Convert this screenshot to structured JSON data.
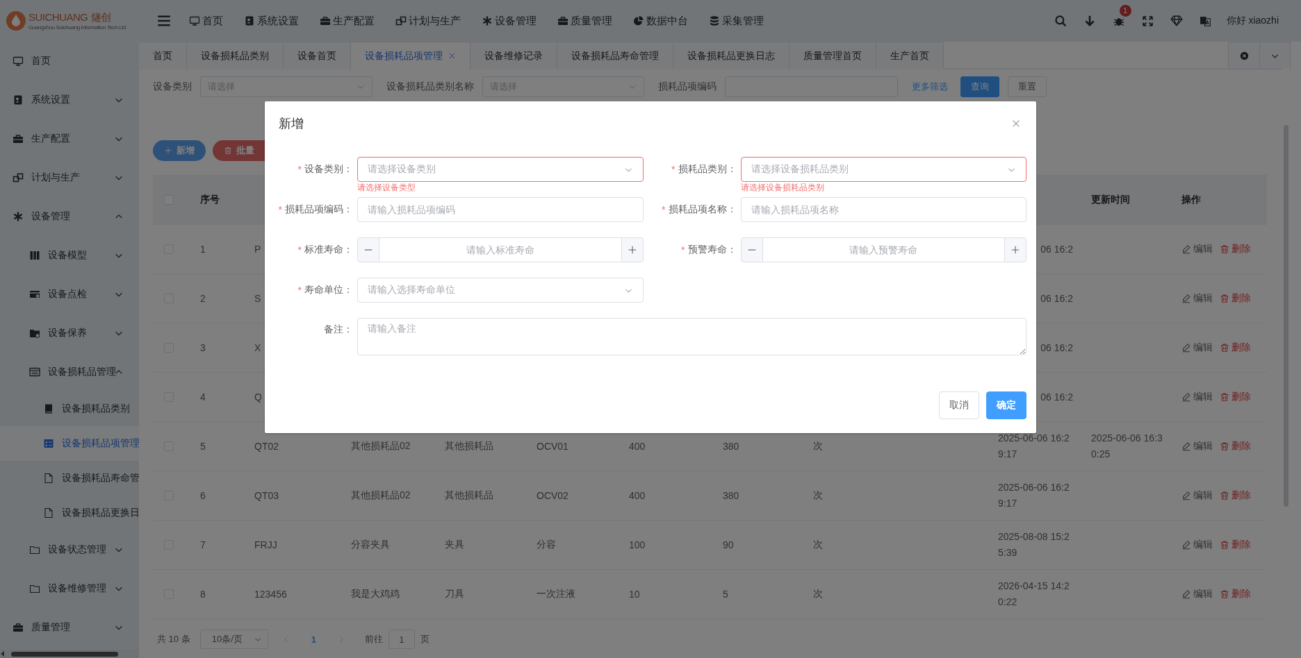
{
  "header": {
    "logo": {
      "brand": "SUICHUANG",
      "brand_cn": "燧创",
      "tagline": "Guangzhou Suichuang Information Tech Ltd"
    },
    "menu": [
      "首页",
      "系统设置",
      "生产配置",
      "计划与生产",
      "设备管理",
      "质量管理",
      "数据中台",
      "采集管理"
    ],
    "notification_badge": "1",
    "greeting": "你好 xiaozhi"
  },
  "sidebar": {
    "items": [
      {
        "label": "首页",
        "selected": false
      },
      {
        "label": "系统设置",
        "selected": false,
        "expanded": false
      },
      {
        "label": "生产配置",
        "selected": false,
        "expanded": false
      },
      {
        "label": "计划与生产",
        "selected": false,
        "expanded": false
      },
      {
        "label": "设备管理",
        "selected": false,
        "expanded": true,
        "children": [
          {
            "label": "设备模型",
            "selected": false,
            "expanded": false
          },
          {
            "label": "设备点检",
            "selected": false,
            "expanded": false
          },
          {
            "label": "设备保养",
            "selected": false,
            "expanded": false
          },
          {
            "label": "设备损耗品管理",
            "selected": false,
            "expanded": true,
            "children": [
              {
                "label": "设备损耗品类别",
                "selected": false
              },
              {
                "label": "设备损耗品项管理",
                "selected": true
              },
              {
                "label": "设备损耗品寿命管",
                "selected": false
              },
              {
                "label": "设备损耗品更换日",
                "selected": false
              }
            ]
          },
          {
            "label": "设备状态管理",
            "selected": false,
            "expanded": false
          },
          {
            "label": "设备维修管理",
            "selected": false,
            "expanded": false
          }
        ]
      },
      {
        "label": "质量管理",
        "selected": false,
        "expanded": false
      }
    ]
  },
  "tabs": [
    {
      "label": "首页",
      "selected": false
    },
    {
      "label": "设备损耗品类别",
      "selected": false
    },
    {
      "label": "设备首页",
      "selected": false
    },
    {
      "label": "设备损耗品项管理",
      "selected": true
    },
    {
      "label": "设备维修记录",
      "selected": false
    },
    {
      "label": "设备损耗品寿命管理",
      "selected": false
    },
    {
      "label": "设备损耗品更换日志",
      "selected": false
    },
    {
      "label": "质量管理首页",
      "selected": false
    },
    {
      "label": "生产首页",
      "selected": false
    }
  ],
  "filters": {
    "fields": [
      {
        "kind": "select",
        "label": "设备类别",
        "placeholder": "请选择"
      },
      {
        "kind": "select",
        "label": "设备损耗品类别名称",
        "placeholder": "请选择"
      },
      {
        "kind": "input",
        "label": "损耗品项编码"
      }
    ],
    "more_link": "更多筛选",
    "buttons": [
      {
        "kind": "primary",
        "label": "查询"
      },
      {
        "kind": "default",
        "label": "重置"
      }
    ]
  },
  "toolbar": [
    {
      "kind": "add",
      "label": "新增"
    },
    {
      "kind": "batch_delete",
      "label": "批量"
    }
  ],
  "table": {
    "header": {
      "checked": false,
      "index": "序号",
      "update_time": "更新时间",
      "actions": "操作"
    },
    "rows": [
      {
        "checked": false,
        "index": "1",
        "column_3": "P",
        "column_10": "06 16:2",
        "actions": [
          {
            "kind": "edit",
            "label": "编辑"
          },
          {
            "kind": "delete",
            "label": "删除"
          }
        ]
      },
      {
        "checked": false,
        "index": "2",
        "column_3": "S",
        "column_10": "06 16:2",
        "actions": [
          {
            "kind": "edit",
            "label": "编辑"
          },
          {
            "kind": "delete",
            "label": "删除"
          }
        ]
      },
      {
        "checked": false,
        "index": "3",
        "column_3": "X",
        "column_10": "06 16:2",
        "actions": [
          {
            "kind": "edit",
            "label": "编辑"
          },
          {
            "kind": "delete",
            "label": "删除"
          }
        ]
      },
      {
        "checked": false,
        "index": "4",
        "column_3": "Q",
        "column_10": "06 16:2",
        "actions": [
          {
            "kind": "edit",
            "label": "编辑"
          },
          {
            "kind": "delete",
            "label": "删除"
          }
        ]
      },
      {
        "checked": false,
        "index": "5",
        "column_3": "QT02",
        "column_4": "其他损耗品02",
        "column_5": "其他损耗品",
        "column_6": "OCV01",
        "column_7": "400",
        "column_8": "380",
        "column_9": "次",
        "column_10": "2025-06-06 16:29:17",
        "update_time": "2025-06-06 16:30:25",
        "actions": [
          {
            "kind": "edit",
            "label": "编辑"
          },
          {
            "kind": "delete",
            "label": "删除"
          }
        ]
      },
      {
        "checked": false,
        "index": "6",
        "column_3": "QT03",
        "column_4": "其他损耗品02",
        "column_5": "其他损耗品",
        "column_6": "OCV02",
        "column_7": "400",
        "column_8": "380",
        "column_9": "次",
        "column_10": "2025-06-06 16:29:17",
        "actions": [
          {
            "kind": "edit",
            "label": "编辑"
          },
          {
            "kind": "delete",
            "label": "删除"
          }
        ]
      },
      {
        "checked": false,
        "index": "7",
        "column_3": "FRJJ",
        "column_4": "分容夹具",
        "column_5": "夹具",
        "column_6": "分容",
        "column_7": "100",
        "column_8": "90",
        "column_9": "次",
        "column_10": "2025-08-08 15:25:39",
        "actions": [
          {
            "kind": "edit",
            "label": "编辑"
          },
          {
            "kind": "delete",
            "label": "删除"
          }
        ]
      },
      {
        "checked": false,
        "index": "8",
        "column_3": "123456",
        "column_4": "我是大鸡鸡",
        "column_5": "刀具",
        "column_6": "一次注液",
        "column_7": "10",
        "column_8": "5",
        "column_9": "次",
        "column_10": "2026-04-15 14:20:22",
        "actions": [
          {
            "kind": "edit",
            "label": "编辑"
          },
          {
            "kind": "delete",
            "label": "删除"
          }
        ]
      }
    ]
  },
  "pager": {
    "total": "共 10 条",
    "page_size": "10条/页",
    "pages": [
      {
        "label": "1",
        "selected": true
      }
    ],
    "jump_label": "前往",
    "jump_value": "1",
    "jump_suffix": "页"
  },
  "dialog": {
    "title": "新增",
    "fields": [
      {
        "kind": "select",
        "required_mark": "*",
        "label": "设备类别：",
        "placeholder": "请选择设备类别",
        "error": "请选择设备类型"
      },
      {
        "kind": "select",
        "required_mark": "*",
        "label": "损耗品类别：",
        "placeholder": "请选择设备损耗品类别",
        "error": "请选择设备损耗品类别"
      },
      {
        "kind": "input",
        "required_mark": "*",
        "label": "损耗品项编码：",
        "placeholder": "请输入损耗品项编码"
      },
      {
        "kind": "input",
        "required_mark": "*",
        "label": "损耗品项名称：",
        "placeholder": "请输入损耗品项名称"
      },
      {
        "kind": "number",
        "required_mark": "*",
        "label": "标准寿命：",
        "placeholder": "请输入标准寿命"
      },
      {
        "kind": "number",
        "required_mark": "*",
        "label": "预警寿命：",
        "placeholder": "请输入预警寿命"
      },
      {
        "kind": "select",
        "required_mark": "*",
        "label": "寿命单位：",
        "placeholder": "请输入选择寿命单位"
      },
      {
        "kind": "textarea",
        "label": "备注：",
        "placeholder": "请输入备注"
      }
    ],
    "buttons": [
      {
        "kind": "default",
        "label": "取消"
      },
      {
        "kind": "primary",
        "label": "确定"
      }
    ]
  }
}
